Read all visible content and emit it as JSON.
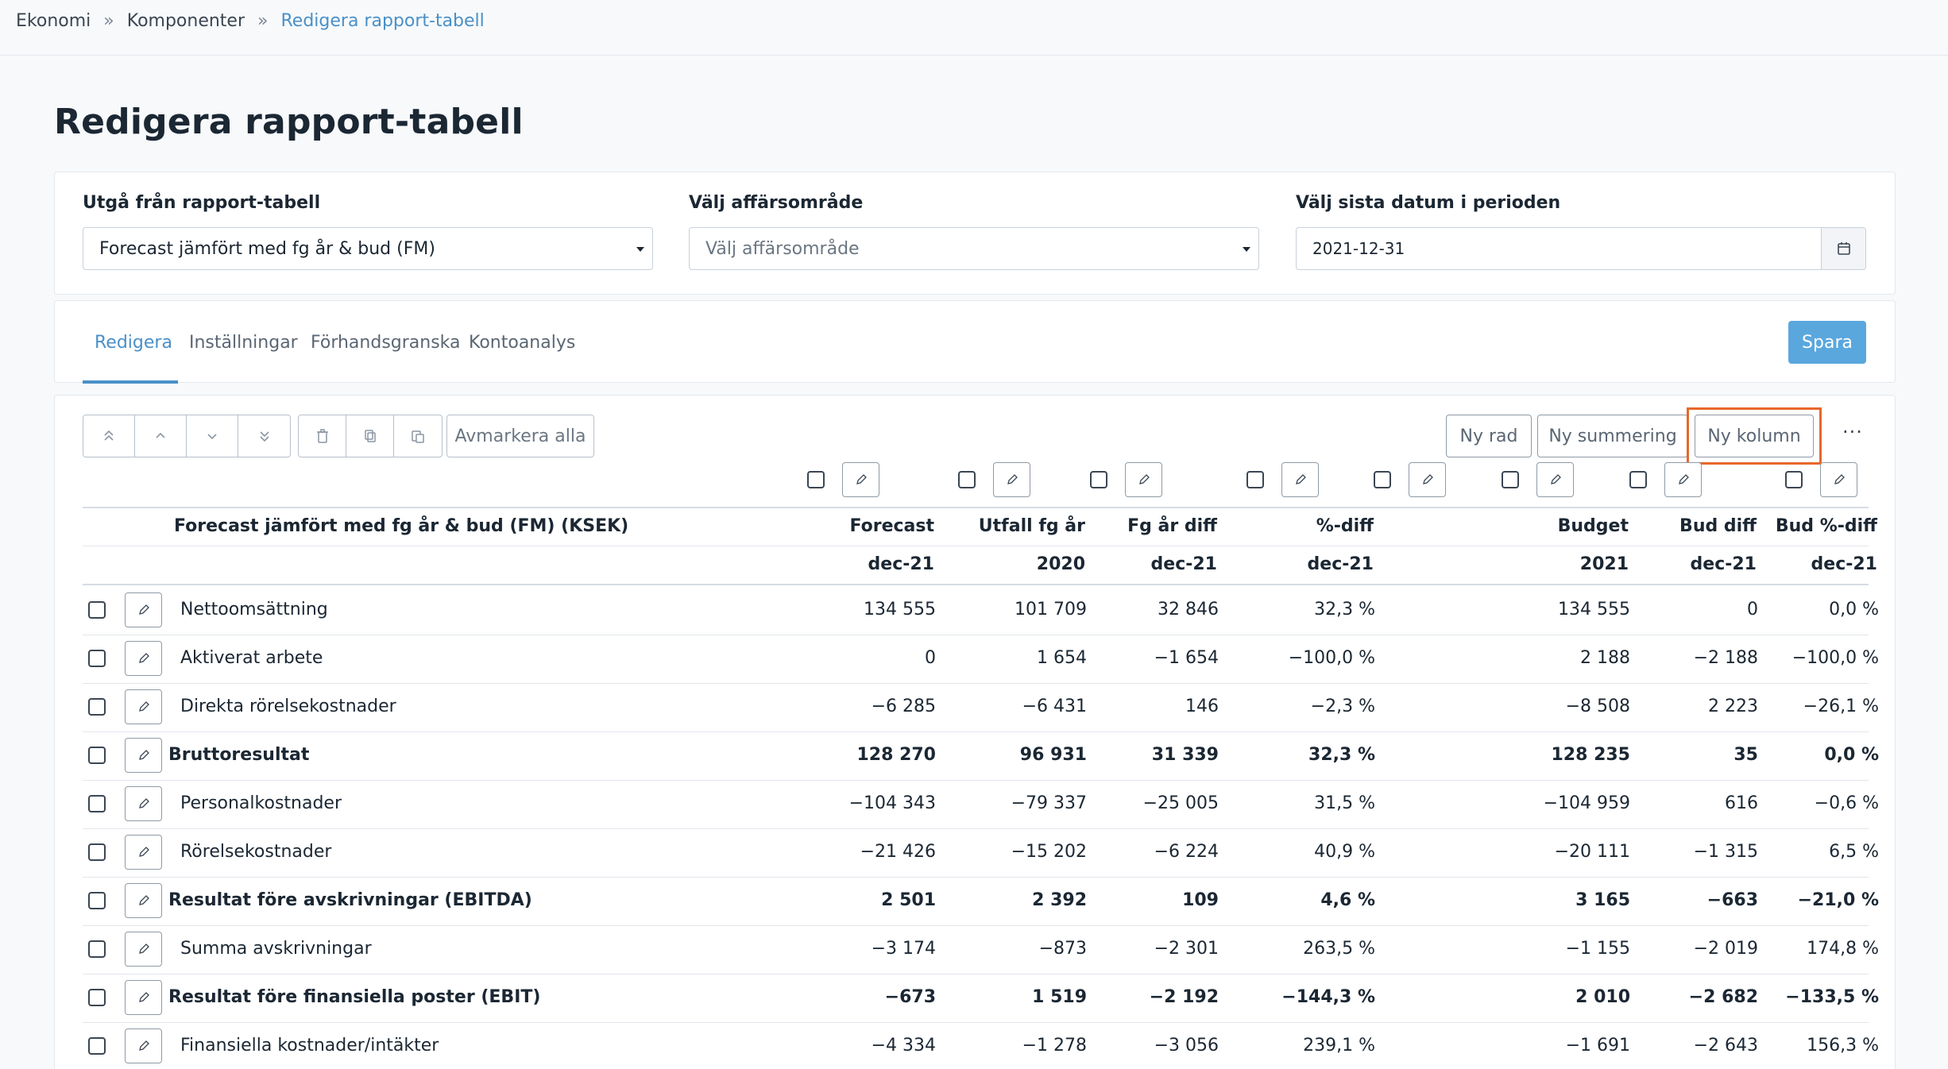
{
  "breadcrumb": [
    "Ekonomi",
    "Komponenter",
    "Redigera rapport-tabell"
  ],
  "breadcrumb_separator": "»",
  "page_title": "Redigera rapport-tabell",
  "filters": {
    "report_table": {
      "label": "Utgå från rapport-tabell",
      "value": "Forecast jämfört med fg år & bud (FM)"
    },
    "business_area": {
      "label": "Välj affärsområde",
      "placeholder": "Välj affärsområde"
    },
    "last_date": {
      "label": "Välj sista datum i perioden",
      "value": "2021-12-31"
    }
  },
  "tabs": [
    {
      "label": "Redigera",
      "active": true
    },
    {
      "label": "Inställningar",
      "active": false
    },
    {
      "label": "Förhandsgranska",
      "active": false
    },
    {
      "label": "Kontoanalys",
      "active": false
    }
  ],
  "save_label": "Spara",
  "toolbar": {
    "deselect_all": "Avmarkera alla",
    "new_row": "Ny rad",
    "new_summary": "Ny summering",
    "new_column": "Ny kolumn",
    "more": "···"
  },
  "table": {
    "title": "Forecast jämfört med fg år & bud (FM) (KSEK)",
    "columns": [
      {
        "header": "Forecast",
        "sub": "dec-21"
      },
      {
        "header": "Utfall fg år",
        "sub": "2020"
      },
      {
        "header": "Fg år diff",
        "sub": "dec-21"
      },
      {
        "header": "%-diff",
        "sub": "dec-21"
      },
      {
        "header": "Budget",
        "sub": "2021"
      },
      {
        "header": "Bud diff",
        "sub": "dec-21"
      },
      {
        "header": "Bud %-diff",
        "sub": "dec-21"
      }
    ],
    "rows": [
      {
        "label": "Nettoomsättning",
        "bold": false,
        "values": [
          "134 555",
          "101 709",
          "32 846",
          "32,3 %",
          "134 555",
          "0",
          "0,0 %"
        ]
      },
      {
        "label": "Aktiverat arbete",
        "bold": false,
        "values": [
          "0",
          "1 654",
          "−1 654",
          "−100,0 %",
          "2 188",
          "−2 188",
          "−100,0 %"
        ]
      },
      {
        "label": "Direkta rörelsekostnader",
        "bold": false,
        "values": [
          "−6 285",
          "−6 431",
          "146",
          "−2,3 %",
          "−8 508",
          "2 223",
          "−26,1 %"
        ]
      },
      {
        "label": "Bruttoresultat",
        "bold": true,
        "values": [
          "128 270",
          "96 931",
          "31 339",
          "32,3 %",
          "128 235",
          "35",
          "0,0 %"
        ]
      },
      {
        "label": "Personalkostnader",
        "bold": false,
        "values": [
          "−104 343",
          "−79 337",
          "−25 005",
          "31,5 %",
          "−104 959",
          "616",
          "−0,6 %"
        ]
      },
      {
        "label": "Rörelsekostnader",
        "bold": false,
        "values": [
          "−21 426",
          "−15 202",
          "−6 224",
          "40,9 %",
          "−20 111",
          "−1 315",
          "6,5 %"
        ]
      },
      {
        "label": "Resultat före avskrivningar (EBITDA)",
        "bold": true,
        "values": [
          "2 501",
          "2 392",
          "109",
          "4,6 %",
          "3 165",
          "−663",
          "−21,0 %"
        ]
      },
      {
        "label": "Summa avskrivningar",
        "bold": false,
        "values": [
          "−3 174",
          "−873",
          "−2 301",
          "263,5 %",
          "−1 155",
          "−2 019",
          "174,8 %"
        ]
      },
      {
        "label": "Resultat före finansiella poster (EBIT)",
        "bold": true,
        "values": [
          "−673",
          "1 519",
          "−2 192",
          "−144,3 %",
          "2 010",
          "−2 682",
          "−133,5 %"
        ]
      },
      {
        "label": "Finansiella kostnader/intäkter",
        "bold": false,
        "values": [
          "−4 334",
          "−1 278",
          "−3 056",
          "239,1 %",
          "−1 691",
          "−2 643",
          "156,3 %"
        ]
      }
    ]
  },
  "colors": {
    "accent": "#4a90c8",
    "save_button": "#5aa7de",
    "highlight": "#e8672a"
  }
}
